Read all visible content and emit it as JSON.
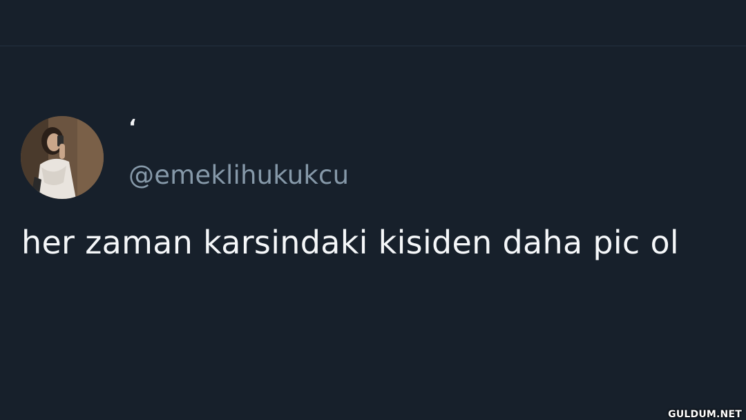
{
  "tweet": {
    "display_name": "‘",
    "handle": "@emeklihukukcu",
    "text": "her zaman karsindaki kisiden daha pic ol",
    "avatar_icon": "profile-photo"
  },
  "watermark": {
    "text": "GULDUM.NET"
  },
  "colors": {
    "background": "#17202b",
    "handle": "#8699a9",
    "text": "#f5f7f9"
  }
}
